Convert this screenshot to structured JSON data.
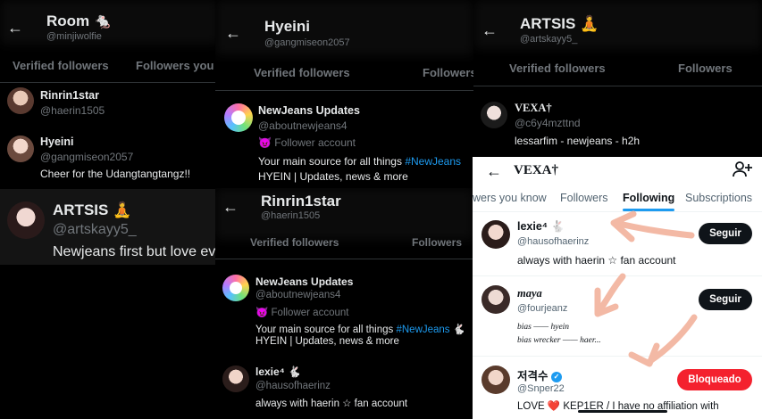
{
  "panel1": {
    "title": "Room",
    "title_emoji": "🐁",
    "handle": "@minjiwolfie",
    "tabs": [
      "Verified followers",
      "Followers you kr"
    ],
    "users": [
      {
        "name": "Rinrin1star",
        "handle": "@haerin1505",
        "bio": ""
      },
      {
        "name": "Hyeini",
        "handle": "@gangmiseon2057",
        "bio": "Cheer for the Udangtangtangz!!"
      },
      {
        "name": "ARTSIS",
        "name_emoji": "🧘",
        "handle": "@artskayy5_",
        "bio": "Newjeans first but love ev"
      }
    ]
  },
  "panel2": {
    "title": "Hyeini",
    "handle": "@gangmiseon2057",
    "tabs": [
      "Verified followers",
      "Followers"
    ],
    "user": {
      "name": "NewJeans Updates",
      "handle": "@aboutnewjeans4",
      "label": "Follower account",
      "bio1_prefix": "Your main source for all things ",
      "bio1_link": "#NewJeans",
      "bio2": "HYEIN | Updates, news & more"
    }
  },
  "panel3": {
    "title": "ARTSIS",
    "title_emoji": "🧘",
    "handle": "@artskayy5_",
    "tabs": [
      "Verified followers",
      "Followers"
    ],
    "user": {
      "name": "VEXA†",
      "handle": "@c6y4mzttnd",
      "bio": "lessarfim - newjeans - h2h"
    }
  },
  "panel4": {
    "title": "Rinrin1star",
    "handle": "@haerin1505",
    "tabs": [
      "Verified followers",
      "Followers"
    ],
    "users": [
      {
        "name": "NewJeans Updates",
        "handle": "@aboutnewjeans4",
        "label": "Follower account",
        "bio1_prefix": "Your main source for all things ",
        "bio1_link": "#NewJeans",
        "bio1_emoji": "🐇",
        "bio2": "HYEIN | Updates, news & more"
      },
      {
        "name": "lexie⁴",
        "name_emoji": "🐇",
        "handle": "@hausofhaerinz",
        "bio": "always with haerin ☆ fan account"
      }
    ]
  },
  "panel5": {
    "title": "VEXA†",
    "tabs": [
      "wers you know",
      "Followers",
      "Following",
      "Subscriptions"
    ],
    "active_tab": "Following",
    "users": [
      {
        "name": "lexie⁴",
        "name_emoji": "🐇",
        "handle": "@hausofhaerinz",
        "bio": "always with haerin ☆ fan account",
        "button": "Seguir"
      },
      {
        "name": "maya",
        "handle": "@fourjeanz",
        "bio1": "bias —— hyein",
        "bio2": "bias wrecker —— haer...",
        "button": "Seguir"
      },
      {
        "name": "저격수",
        "handle": "@Snper22",
        "bio": "LOVE ❤️ KEP1ER / I have no affiliation with",
        "button": "Bloqueado"
      }
    ],
    "colors": {
      "accent": "#1d9bf0",
      "blocked": "#f4212e",
      "annotation": "#f3b9a5"
    }
  }
}
